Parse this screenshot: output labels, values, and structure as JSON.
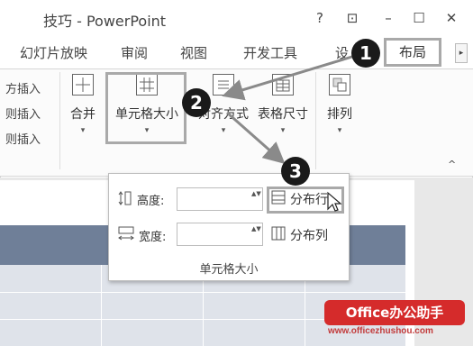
{
  "window": {
    "title": "技巧 - PowerPoint",
    "help": "?",
    "restore_ribbon": "⊡",
    "minimize": "–",
    "maximize": "☐",
    "close": "✕"
  },
  "tabs": {
    "slideshow": "幻灯片放映",
    "review": "审阅",
    "view": "视图",
    "developer": "开发工具",
    "design_cut": "设",
    "layout": "布局",
    "scroll": "▸"
  },
  "ribbon": {
    "left_rows": [
      "方插入",
      "则插入",
      "则插入"
    ],
    "merge": "合并",
    "cell_size": "单元格大小",
    "alignment": "对齐方式",
    "table_size": "表格尺寸",
    "arrange": "排列",
    "caret": "▾",
    "collapse": "^"
  },
  "panel": {
    "height_label": "高度:",
    "width_label": "宽度:",
    "distribute_rows": "分布行",
    "distribute_cols": "分布列",
    "group_label": "单元格大小",
    "spin_arrows": "▲▼"
  },
  "callouts": [
    "1",
    "2",
    "3"
  ],
  "watermark": {
    "brand": "Office办公助手",
    "url": "www.officezhushou.com"
  },
  "colors": {
    "callout": "#1a1a1a",
    "highlight": "#a9a9a9",
    "table_header": "#6f7f98",
    "watermark": "#d52b2b"
  }
}
